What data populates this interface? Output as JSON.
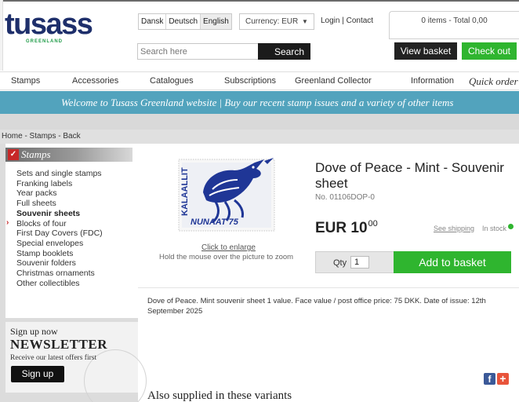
{
  "header": {
    "logo_text": "tusass",
    "logo_sub": "GREENLAND",
    "languages": [
      "Dansk",
      "Deutsch",
      "English"
    ],
    "currency_label": "Currency: EUR",
    "login_contact": "Login | Contact",
    "basket_summary": "0 items - Total 0,00",
    "search_placeholder": "Search here",
    "search_button": "Search",
    "view_basket": "View basket",
    "check_out": "Check out"
  },
  "nav": {
    "items": [
      "Stamps",
      "Accessories",
      "Catalogues",
      "Subscriptions",
      "Greenland Collector",
      "Information",
      "Quick order"
    ]
  },
  "banner": "Welcome to Tusass Greenland website | Buy our recent stamp issues and a variety of other items",
  "breadcrumb": "Home - Stamps - Back",
  "sidebar": {
    "heading": "Stamps",
    "items": [
      "Sets and single stamps",
      "Franking labels",
      "Year packs",
      "Full sheets",
      "Souvenir sheets",
      "Blocks of four",
      "First Day Covers (FDC)",
      "Special envelopes",
      "Stamp booklets",
      "Souvenir folders",
      "Christmas ornaments",
      "Other collectibles"
    ],
    "active_index": 4
  },
  "newsletter": {
    "line1": "Sign up now",
    "line2": "NEWSLETTER",
    "line3": "Receive our latest offers first",
    "button": "Sign up"
  },
  "product": {
    "stamp_text_left": "KALAALLIT",
    "stamp_text_bottom": "NUNAAT 75",
    "click_to_enlarge": "Click to enlarge",
    "hold_mouse": "Hold the mouse over the picture to zoom",
    "title": "Dove of Peace - Mint - Souvenir sheet",
    "number": "No. 01106DOP-0",
    "price_currency": "EUR",
    "price_main": "10",
    "price_cents": "00",
    "see_shipping": "See shipping",
    "in_stock": "In stock",
    "qty_label": "Qty",
    "qty_value": "1",
    "add_to_basket": "Add to basket",
    "description": "Dove of Peace. Mint souvenir sheet 1 value. Face value / post office price: 75 DKK. Date of issue: 12th September 2025"
  },
  "social": {
    "facebook": "f",
    "plus": "+"
  },
  "variants_heading": "Also supplied in these variants",
  "colors": {
    "banner": "#52a3bd",
    "green": "#2fb52f",
    "logo_blue": "#1e2f6b",
    "stamp_blue": "#1f3696"
  }
}
